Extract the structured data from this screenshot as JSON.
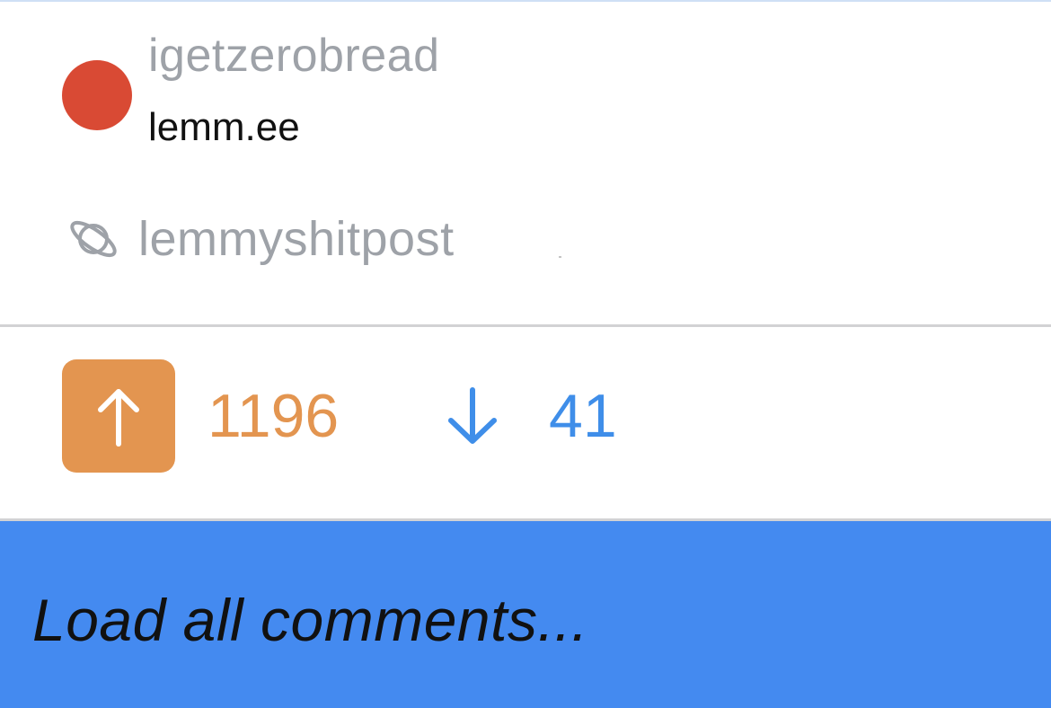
{
  "post": {
    "author": {
      "username": "igetzerobread",
      "instance": "lemm.ee",
      "avatar_color": "#d94a34"
    },
    "community": {
      "name": "lemmyshitpost",
      "icon": "planet-icon"
    },
    "votes": {
      "upvotes": "1196",
      "downvotes": "41",
      "upvote_icon": "arrow-up-icon",
      "downvote_icon": "arrow-down-icon",
      "upvote_color": "#e39550",
      "downvote_color": "#3f8ee9"
    }
  },
  "comments": {
    "load_all_label": "Load all comments...",
    "background_color": "#448af0"
  }
}
